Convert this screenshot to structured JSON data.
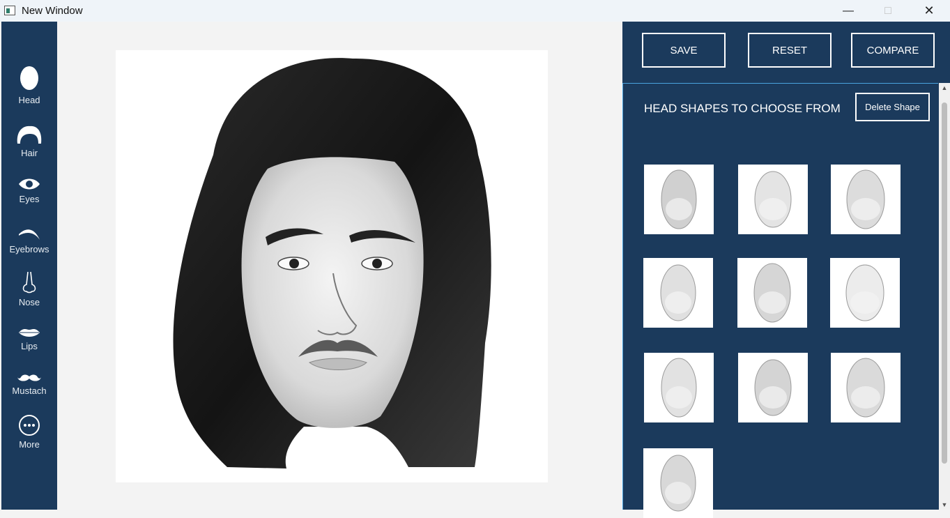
{
  "window": {
    "title": "New Window",
    "icon": "app-window-icon"
  },
  "sidebar": {
    "items": [
      {
        "label": "Head",
        "icon": "head-icon"
      },
      {
        "label": "Hair",
        "icon": "hair-icon"
      },
      {
        "label": "Eyes",
        "icon": "eye-icon"
      },
      {
        "label": "Eyebrows",
        "icon": "eyebrow-icon"
      },
      {
        "label": "Nose",
        "icon": "nose-icon"
      },
      {
        "label": "Lips",
        "icon": "lips-icon"
      },
      {
        "label": "Mustach",
        "icon": "mustache-icon"
      },
      {
        "label": "More",
        "icon": "more-icon"
      }
    ]
  },
  "toolbar": {
    "save_label": "SAVE",
    "reset_label": "RESET",
    "compare_label": "COMPARE"
  },
  "shapes_panel": {
    "title": "HEAD SHAPES TO CHOOSE FROM",
    "delete_label": "Delete Shape",
    "shape_count": 10
  },
  "colors": {
    "sidebar": "#1b3a5c",
    "panel": "#1b3a5c",
    "accent": "#4aa3df"
  }
}
